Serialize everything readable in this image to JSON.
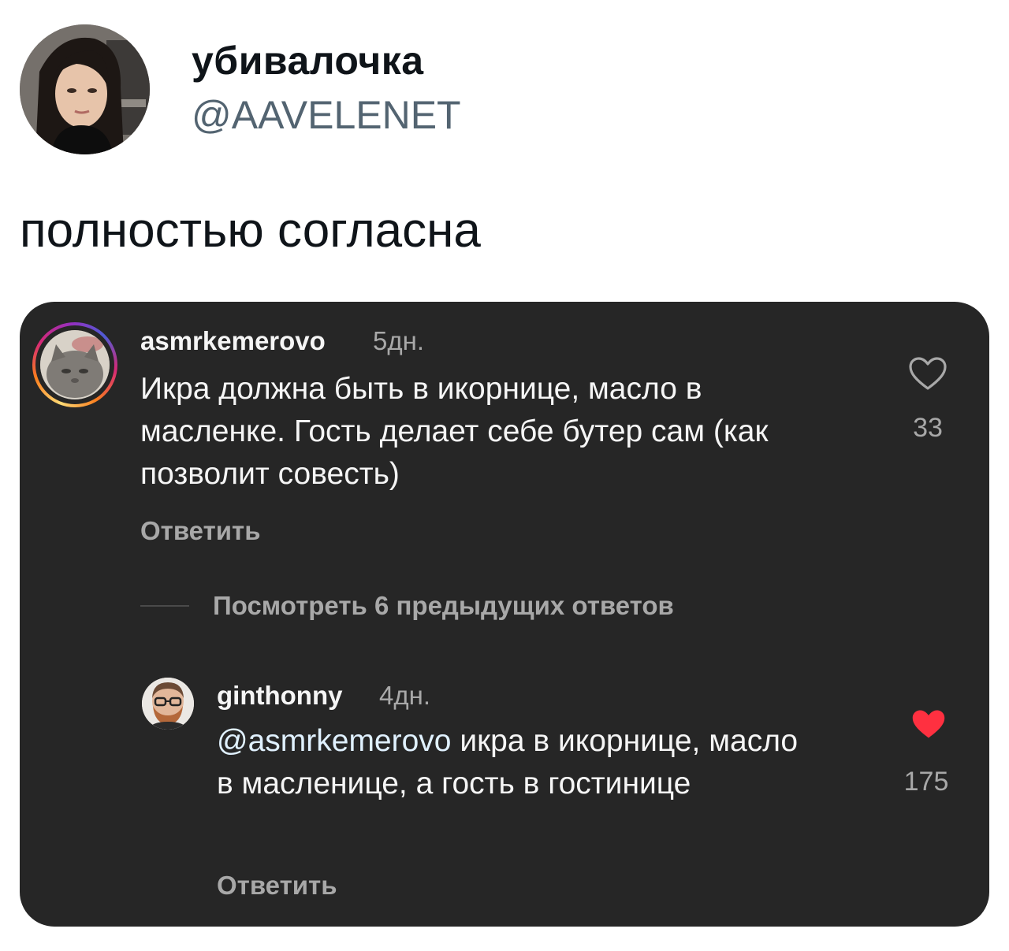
{
  "tweet": {
    "author_name": "убивалочка",
    "author_handle": "@AAVELENET",
    "text": "полностью согласна"
  },
  "embedded": {
    "comments": [
      {
        "username": "asmrkemerovo",
        "time": "5дн.",
        "body": "Икра должна быть в икорнице, масло в масленке. Гость делает себе бутер сам (как позволит совесть)",
        "reply_label": "Ответить",
        "likes": "33",
        "liked": false
      },
      {
        "username": "ginthonny",
        "time": "4дн.",
        "mention": "@asmrkemerovo",
        "body": " икра в икорнице, масло в масленице, а гость в гостинице",
        "reply_label": "Ответить",
        "likes": "175",
        "liked": true
      }
    ],
    "view_replies_label": "Посмотреть 6 предыдущих ответов"
  },
  "colors": {
    "card_background": "#262626",
    "like_active": "#ff3040",
    "handle": "#536471"
  },
  "icons": [
    "heart-outline-icon",
    "heart-filled-icon"
  ]
}
